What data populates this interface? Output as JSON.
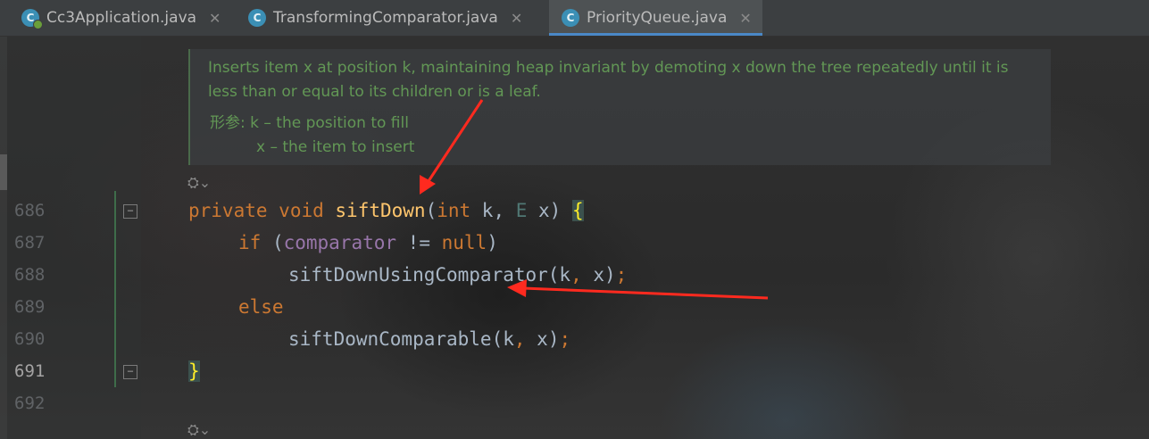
{
  "tabs": [
    {
      "label": "Cc3Application.java",
      "close": "✕",
      "icon": "class-icon",
      "active": false
    },
    {
      "label": "TransformingComparator.java",
      "close": "✕",
      "icon": "class-icon",
      "active": false
    },
    {
      "label": "PriorityQueue.java",
      "close": "✕",
      "icon": "class-icon",
      "active": true
    }
  ],
  "doc": {
    "text": "Inserts item x at position k, maintaining heap invariant by demoting x down the tree repeatedly until it is less than or equal to its children or is a leaf.",
    "params_label": "形参:",
    "param1": "k – the position to fill",
    "param2": "x – the item to insert"
  },
  "line_numbers": [
    "686",
    "687",
    "688",
    "689",
    "690",
    "691",
    "692"
  ],
  "code": {
    "l686": {
      "kw1": "private",
      "kw2": "void",
      "name": "siftDown",
      "open": "(",
      "kw3": "int",
      "rest": " k, ",
      "typ": "E",
      "rest2": " x) ",
      "brace": "{"
    },
    "l687": {
      "kw": "if",
      "open": " (",
      "field": "comparator",
      "rest": " != ",
      "kw2": "null",
      "close": ")"
    },
    "l688": {
      "text": "siftDownUsingComparator(k",
      "comma": ",",
      "rest": " x)",
      "semi": ";"
    },
    "l689": {
      "kw": "else"
    },
    "l690": {
      "text": "siftDownComparable(k",
      "comma": ",",
      "rest": " x)",
      "semi": ";"
    },
    "l691": {
      "brace": "}"
    }
  },
  "colors": {
    "accent": "#4a88c7",
    "arrow": "#ff2a1f"
  }
}
